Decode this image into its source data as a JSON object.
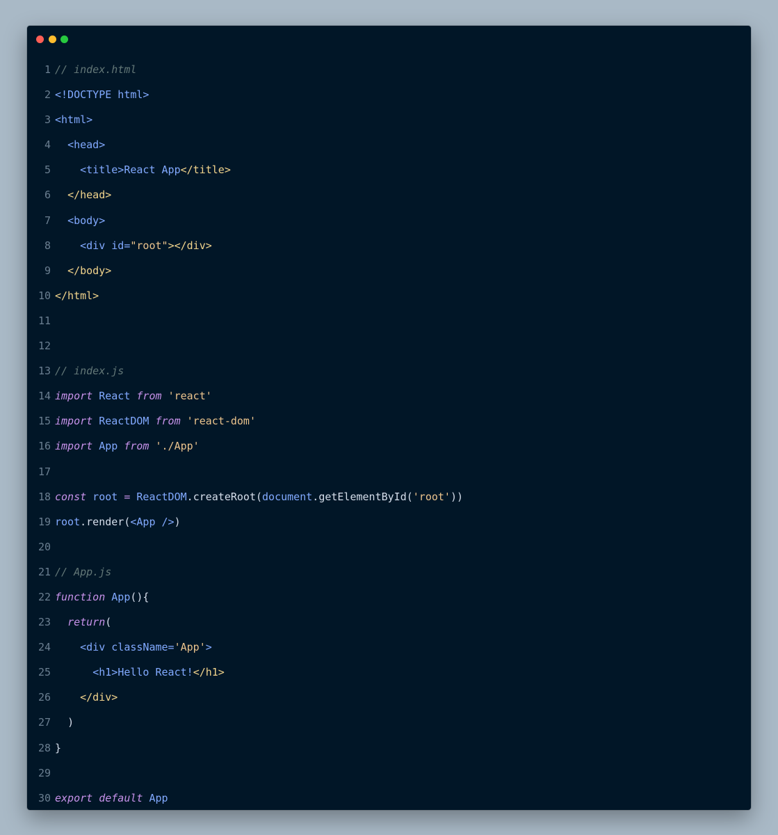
{
  "window": {
    "controls": [
      "close",
      "minimize",
      "maximize"
    ]
  },
  "code": {
    "lines": [
      {
        "n": "1",
        "tokens": [
          {
            "t": "// index.html",
            "c": "comment"
          }
        ]
      },
      {
        "n": "2",
        "tokens": [
          {
            "t": "<!DOCTYPE html>",
            "c": "html"
          }
        ]
      },
      {
        "n": "3",
        "tokens": [
          {
            "t": "<html>",
            "c": "html"
          }
        ]
      },
      {
        "n": "4",
        "tokens": [
          {
            "t": "  ",
            "c": "plain"
          },
          {
            "t": "<head>",
            "c": "html"
          }
        ]
      },
      {
        "n": "5",
        "tokens": [
          {
            "t": "    ",
            "c": "plain"
          },
          {
            "t": "<title>",
            "c": "html"
          },
          {
            "t": "React App",
            "c": "html"
          },
          {
            "t": "</title>",
            "c": "closetag"
          }
        ]
      },
      {
        "n": "6",
        "tokens": [
          {
            "t": "  ",
            "c": "plain"
          },
          {
            "t": "</head>",
            "c": "closetag"
          }
        ]
      },
      {
        "n": "7",
        "tokens": [
          {
            "t": "  ",
            "c": "plain"
          },
          {
            "t": "<body>",
            "c": "html"
          }
        ]
      },
      {
        "n": "8",
        "tokens": [
          {
            "t": "    ",
            "c": "plain"
          },
          {
            "t": "<div ",
            "c": "html"
          },
          {
            "t": "id=",
            "c": "html"
          },
          {
            "t": "\"root\"",
            "c": "str"
          },
          {
            "t": "></div>",
            "c": "closetag"
          }
        ]
      },
      {
        "n": "9",
        "tokens": [
          {
            "t": "  ",
            "c": "plain"
          },
          {
            "t": "</body>",
            "c": "closetag"
          }
        ]
      },
      {
        "n": "10",
        "tokens": [
          {
            "t": "</html>",
            "c": "closetag"
          }
        ]
      },
      {
        "n": "11",
        "tokens": []
      },
      {
        "n": "12",
        "tokens": []
      },
      {
        "n": "13",
        "tokens": [
          {
            "t": "// index.js",
            "c": "comment"
          }
        ]
      },
      {
        "n": "14",
        "tokens": [
          {
            "t": "import",
            "c": "kw"
          },
          {
            "t": " React ",
            "c": "name"
          },
          {
            "t": "from",
            "c": "kw"
          },
          {
            "t": " ",
            "c": "plain"
          },
          {
            "t": "'react'",
            "c": "str"
          }
        ]
      },
      {
        "n": "15",
        "tokens": [
          {
            "t": "import",
            "c": "kw"
          },
          {
            "t": " ReactDOM ",
            "c": "name"
          },
          {
            "t": "from",
            "c": "kw"
          },
          {
            "t": " ",
            "c": "plain"
          },
          {
            "t": "'react-dom'",
            "c": "str"
          }
        ]
      },
      {
        "n": "16",
        "tokens": [
          {
            "t": "import",
            "c": "kw"
          },
          {
            "t": " App ",
            "c": "name"
          },
          {
            "t": "from",
            "c": "kw"
          },
          {
            "t": " ",
            "c": "plain"
          },
          {
            "t": "'./App'",
            "c": "str"
          }
        ]
      },
      {
        "n": "17",
        "tokens": []
      },
      {
        "n": "18",
        "tokens": [
          {
            "t": "const",
            "c": "kw"
          },
          {
            "t": " root ",
            "c": "name"
          },
          {
            "t": "= ",
            "c": "punct"
          },
          {
            "t": "ReactDOM",
            "c": "name"
          },
          {
            "t": ".",
            "c": "plain"
          },
          {
            "t": "createRoot",
            "c": "fn"
          },
          {
            "t": "(",
            "c": "plain"
          },
          {
            "t": "document",
            "c": "name"
          },
          {
            "t": ".",
            "c": "plain"
          },
          {
            "t": "getElementById",
            "c": "fn"
          },
          {
            "t": "(",
            "c": "plain"
          },
          {
            "t": "'root'",
            "c": "str"
          },
          {
            "t": "))",
            "c": "plain"
          }
        ]
      },
      {
        "n": "19",
        "tokens": [
          {
            "t": "root",
            "c": "name"
          },
          {
            "t": ".",
            "c": "plain"
          },
          {
            "t": "render",
            "c": "fn"
          },
          {
            "t": "(",
            "c": "plain"
          },
          {
            "t": "<App />",
            "c": "html"
          },
          {
            "t": ")",
            "c": "plain"
          }
        ]
      },
      {
        "n": "20",
        "tokens": []
      },
      {
        "n": "21",
        "tokens": [
          {
            "t": "// App.js",
            "c": "comment"
          }
        ]
      },
      {
        "n": "22",
        "tokens": [
          {
            "t": "function",
            "c": "kw"
          },
          {
            "t": " App",
            "c": "name"
          },
          {
            "t": "(){",
            "c": "plain"
          }
        ]
      },
      {
        "n": "23",
        "tokens": [
          {
            "t": "  ",
            "c": "plain"
          },
          {
            "t": "return",
            "c": "kw"
          },
          {
            "t": "(",
            "c": "plain"
          }
        ]
      },
      {
        "n": "24",
        "tokens": [
          {
            "t": "    ",
            "c": "plain"
          },
          {
            "t": "<div ",
            "c": "html"
          },
          {
            "t": "className=",
            "c": "html"
          },
          {
            "t": "'App'",
            "c": "str"
          },
          {
            "t": ">",
            "c": "html"
          }
        ]
      },
      {
        "n": "25",
        "tokens": [
          {
            "t": "      ",
            "c": "plain"
          },
          {
            "t": "<h1>",
            "c": "html"
          },
          {
            "t": "Hello React!",
            "c": "html"
          },
          {
            "t": "</h1>",
            "c": "closetag"
          }
        ]
      },
      {
        "n": "26",
        "tokens": [
          {
            "t": "    ",
            "c": "plain"
          },
          {
            "t": "</div>",
            "c": "closetag"
          }
        ]
      },
      {
        "n": "27",
        "tokens": [
          {
            "t": "  ",
            "c": "plain"
          },
          {
            "t": ")",
            "c": "plain"
          }
        ]
      },
      {
        "n": "28",
        "tokens": [
          {
            "t": "}",
            "c": "plain"
          }
        ]
      },
      {
        "n": "29",
        "tokens": []
      },
      {
        "n": "30",
        "tokens": [
          {
            "t": "export",
            "c": "kw"
          },
          {
            "t": " ",
            "c": "plain"
          },
          {
            "t": "default",
            "c": "kw"
          },
          {
            "t": " App",
            "c": "name"
          }
        ]
      }
    ]
  }
}
